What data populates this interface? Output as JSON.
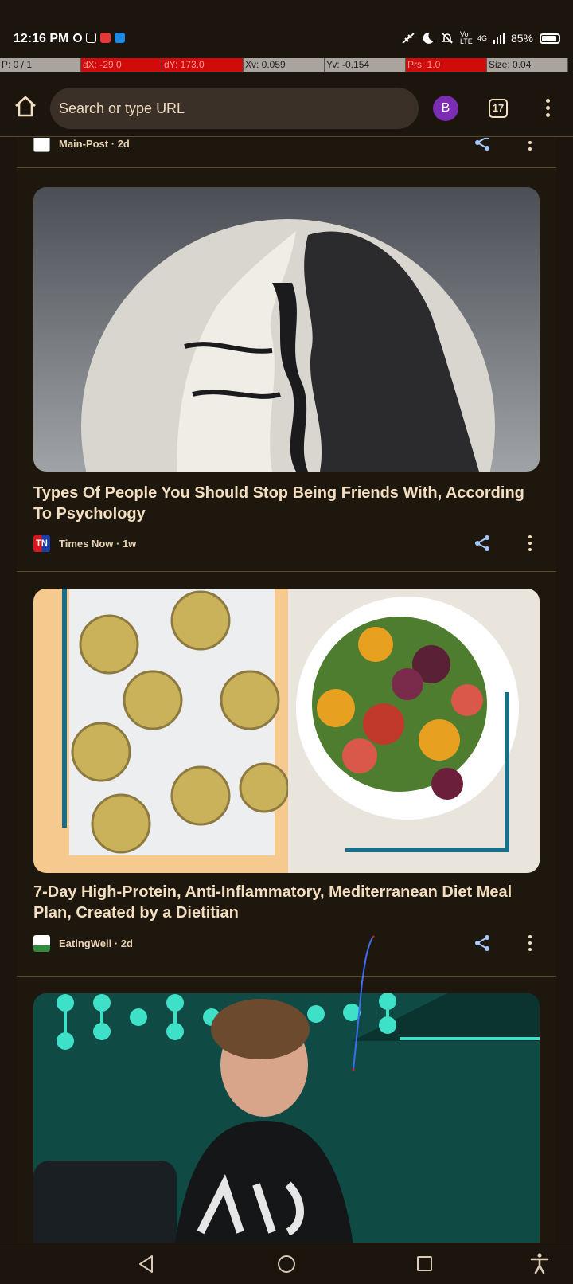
{
  "status_bar": {
    "time": "12:16 PM",
    "battery": "85%",
    "network": "4G",
    "volte": "Vo LTE"
  },
  "debug_bar": {
    "cells": [
      "P: 0 / 1",
      "dX: -29.0",
      "dY: 173.0",
      "Xv: 0.059",
      "Yv: -0.154",
      "Prs: 1.0",
      "Size: 0.04"
    ]
  },
  "toolbar": {
    "url_placeholder": "Search or type URL",
    "avatar_letter": "B",
    "tab_count": "17"
  },
  "feed": {
    "cards": [
      {
        "source": "Main-Post",
        "age": "· 2d"
      },
      {
        "title": "Types Of People You Should Stop Being Friends With, According To Psychology",
        "source": "Times Now",
        "age": "· 1w",
        "favicon_text": "TN",
        "image": "silhouettes-illustration"
      },
      {
        "title": "7-Day High-Protein, Anti-Inflammatory, Mediterranean Diet Meal Plan, Created by a Dietitian",
        "source": "EatingWell",
        "age": "· 2d",
        "image": "egg-muffins-and-beet-salad"
      },
      {
        "image": "man-speaking-on-stage"
      }
    ]
  },
  "colors": {
    "background": "#1c150d",
    "text": "#f3dfbf",
    "accent_share": "#a8c7fa",
    "avatar": "#7b2db3"
  }
}
